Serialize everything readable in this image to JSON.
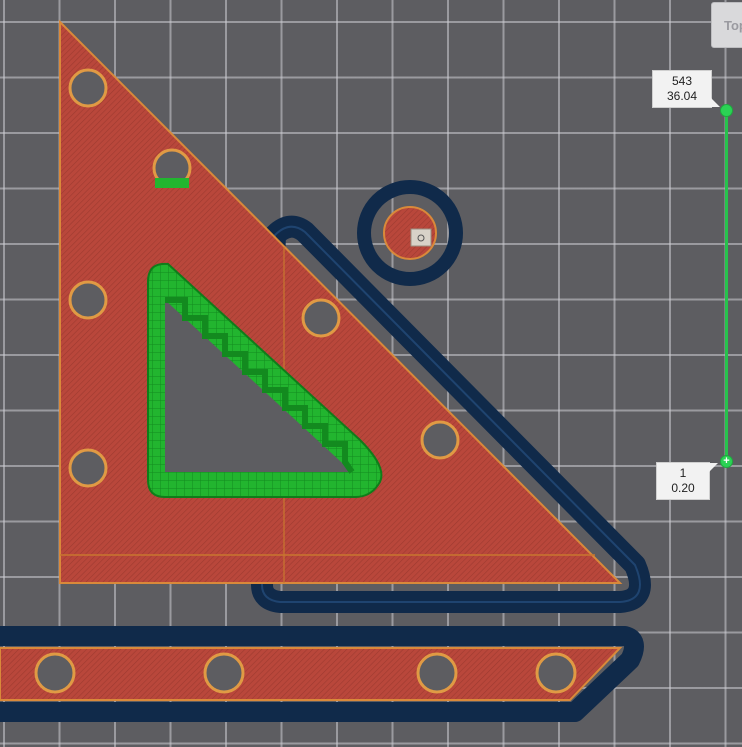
{
  "view_button": {
    "label": "Top"
  },
  "layer_slider": {
    "top_layer": "543",
    "top_height": "36.04",
    "bottom_layer": "1",
    "bottom_height": "0.20",
    "bottom_handle_icon": "plus-icon"
  },
  "colors": {
    "background": "#5d5d61",
    "grid": "#cdcdd2",
    "infill": "#b8493a",
    "perimeter": "#c9772f",
    "support": "#1fbf2f",
    "skirt": "#17355a",
    "slider": "#27c24c"
  }
}
